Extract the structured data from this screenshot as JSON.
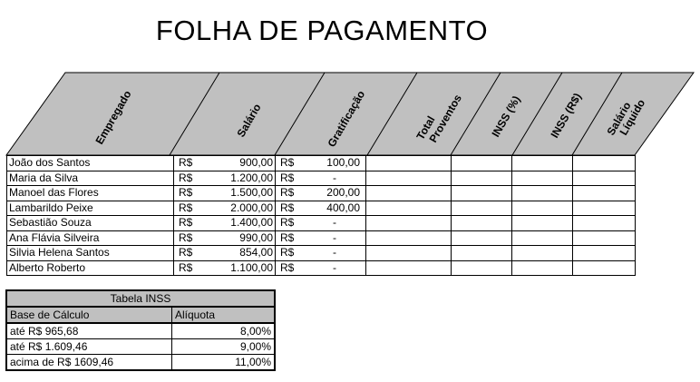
{
  "title": "FOLHA DE PAGAMENTO",
  "headers": {
    "empregado": "Empregado",
    "salario": "Salário",
    "gratificacao": "Gratificação",
    "total_proventos_1": "Total",
    "total_proventos_2": "Proventos",
    "inss_pct": "INSS (%)",
    "inss_rs": "INSS (R$)",
    "salario_liquido_1": "Salário",
    "salario_liquido_2": "Líquido"
  },
  "currency": "R$",
  "employees": [
    {
      "name": "João dos Santos",
      "salary": "900,00",
      "bonus": "100,00"
    },
    {
      "name": "Maria da Silva",
      "salary": "1.200,00",
      "bonus": "-"
    },
    {
      "name": "Manoel das Flores",
      "salary": "1.500,00",
      "bonus": "200,00"
    },
    {
      "name": "Lambarildo Peixe",
      "salary": "2.000,00",
      "bonus": "400,00"
    },
    {
      "name": "Sebastião Souza",
      "salary": "1.400,00",
      "bonus": "-"
    },
    {
      "name": "Ana Flávia Silveira",
      "salary": "990,00",
      "bonus": "-"
    },
    {
      "name": "Silvia Helena Santos",
      "salary": "854,00",
      "bonus": "-"
    },
    {
      "name": "Alberto Roberto",
      "salary": "1.100,00",
      "bonus": "-"
    }
  ],
  "inss_table": {
    "caption": "Tabela INSS",
    "col_base": "Base de Cálculo",
    "col_rate": "Alíquota",
    "rows": [
      {
        "base": "até R$ 965,68",
        "rate": "8,00%"
      },
      {
        "base": "até R$ 1.609,46",
        "rate": "9,00%"
      },
      {
        "base": "acima de R$ 1609,46",
        "rate": "11,00%"
      }
    ]
  }
}
